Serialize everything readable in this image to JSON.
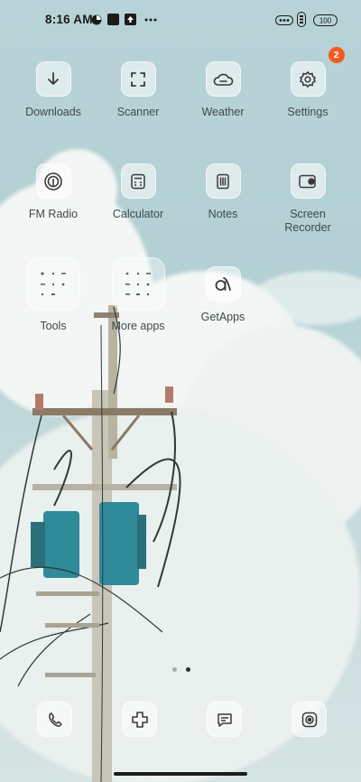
{
  "status_bar": {
    "time": "8:16 AM",
    "battery": "100",
    "icons": [
      "data-saver-icon",
      "screenshot-icon",
      "upload-icon",
      "more-dots-icon",
      "sim-icon",
      "signal-icon"
    ]
  },
  "apps": [
    {
      "label": "Downloads",
      "icon": "download-icon"
    },
    {
      "label": "Scanner",
      "icon": "scanner-icon"
    },
    {
      "label": "Weather",
      "icon": "weather-icon"
    },
    {
      "label": "Settings",
      "icon": "gear-icon",
      "badge": "2"
    },
    {
      "label": "FM Radio",
      "icon": "radio-icon"
    },
    {
      "label": "Calculator",
      "icon": "calculator-icon"
    },
    {
      "label": "Notes",
      "icon": "notes-icon"
    },
    {
      "label": "Screen\nRecorder",
      "icon": "screen-recorder-icon"
    },
    {
      "label": "Tools",
      "icon": "tools-folder-icon"
    },
    {
      "label": "More apps",
      "icon": "more-apps-folder-icon"
    },
    {
      "label": "GetApps",
      "icon": "getapps-icon"
    }
  ],
  "page_indicator": {
    "pages": 2,
    "current": 2
  },
  "dock": [
    {
      "icon": "phone-icon"
    },
    {
      "icon": "gallery-flower-icon"
    },
    {
      "icon": "messages-icon"
    },
    {
      "icon": "camera-icon"
    }
  ],
  "colors": {
    "badge": "#f25c1e",
    "sky": "#b8d3d7",
    "label": "#3c4a4c"
  }
}
